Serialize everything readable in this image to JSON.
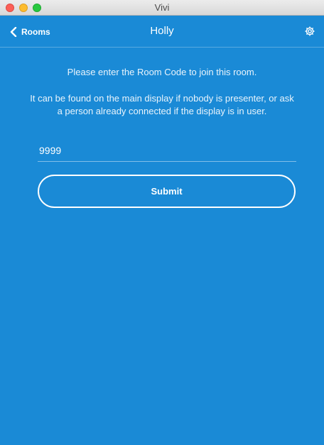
{
  "window": {
    "title": "Vivi"
  },
  "appbar": {
    "back_label": "Rooms",
    "title": "Holly",
    "back_icon": "chevron-left-icon",
    "settings_icon": "gear-icon"
  },
  "form": {
    "prompt": "Please enter the Room Code to join this room.",
    "help": "It can be found on the main display if nobody is presenter, or ask a person already connected if the display is in user.",
    "room_code_value": "9999",
    "submit_label": "Submit"
  },
  "colors": {
    "background": "#1a8ad6",
    "text": "#ffffff"
  }
}
